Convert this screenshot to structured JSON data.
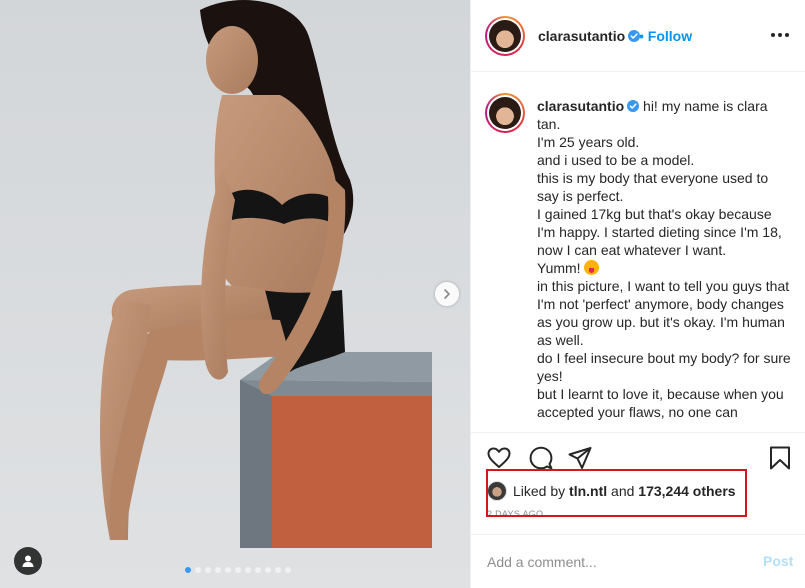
{
  "post": {
    "username": "clarasutantio",
    "verified": true,
    "follow_separator": "•",
    "follow_label": "Follow",
    "image_count": 11,
    "active_image_index": 0
  },
  "caption": {
    "username": "clarasutantio",
    "lines": [
      "hi! my name is clara tan.",
      "I'm 25 years old.",
      "and i used to be a model.",
      "this is my body that everyone used to say is perfect.",
      "I gained 17kg but that's okay because I'm happy. I started dieting since I'm 18, now I can eat whatever I want.",
      "Yumm!",
      "in this picture, I want to tell you guys that I'm not 'perfect' anymore, body changes as you grow up. but it's okay. I'm human as well.",
      "do I feel insecure bout my body? for sure yes!",
      "but I learnt to love it, because when you accepted your flaws, no one can"
    ]
  },
  "likes": {
    "prefix": "Liked by",
    "liked_by": "tln.ntl",
    "joiner": "and",
    "others": "173,244 others"
  },
  "time_ago": "2 DAYS AGO",
  "comment": {
    "placeholder": "Add a comment...",
    "post_label": "Post"
  },
  "icons": {
    "more": "more-options-icon",
    "like": "heart-icon",
    "comment": "comment-bubble-icon",
    "share": "paper-plane-icon",
    "save": "bookmark-icon",
    "next": "chevron-right-icon",
    "tag": "user-tag-icon",
    "verified": "verified-badge-icon"
  },
  "colors": {
    "accent": "#0095f6",
    "post_disabled": "#b2dffc",
    "highlight_box": "#d9141b",
    "verified": "#3897f0"
  }
}
